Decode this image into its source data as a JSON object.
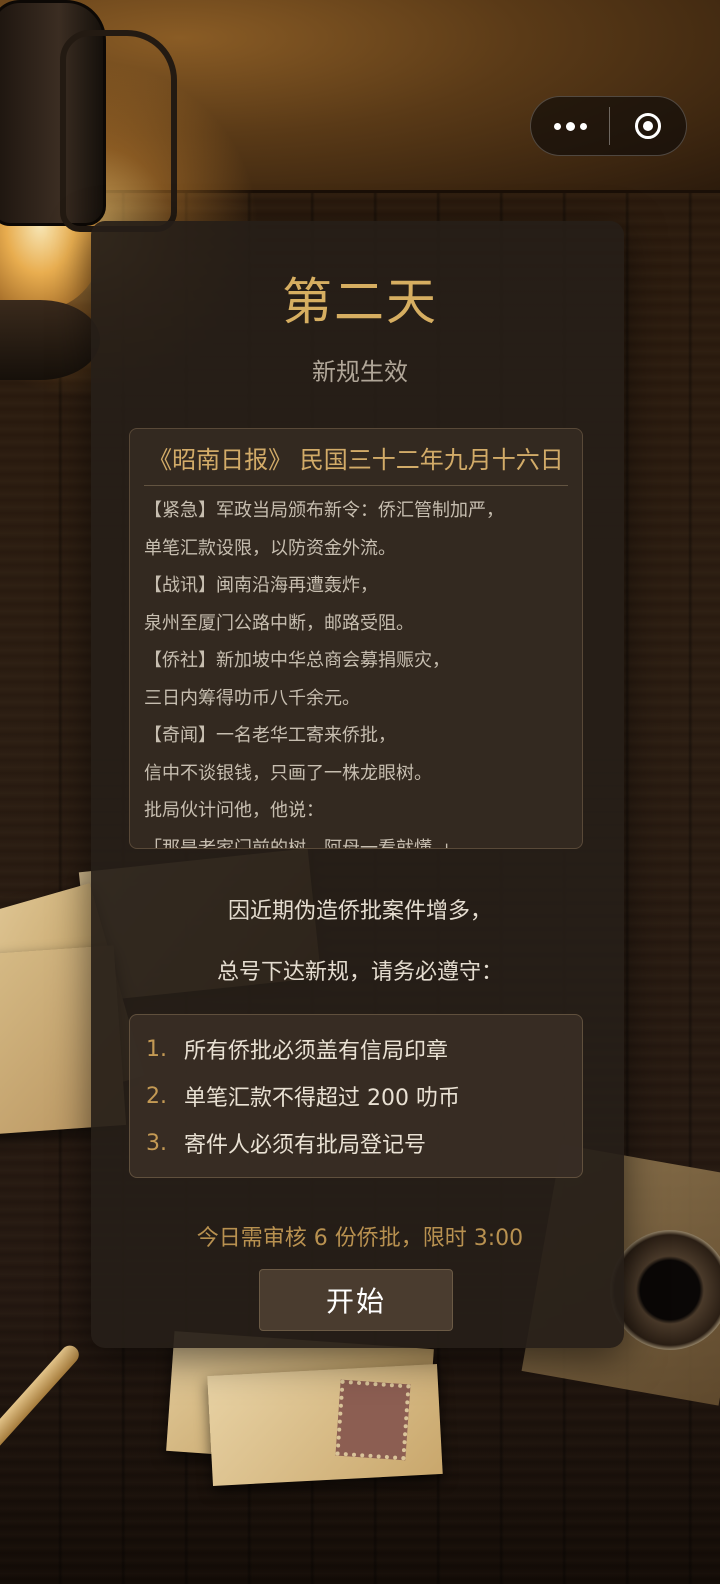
{
  "capsule": {
    "more_icon": "more-dots-icon",
    "close_icon": "target-circle-icon"
  },
  "screen": {
    "title": "第二天",
    "subtitle": "新规生效"
  },
  "newspaper": {
    "header": "《昭南日报》 民国三十二年九月十六日",
    "lines": [
      "【紧急】军政当局颁布新令：侨汇管制加严，",
      "单笔汇款设限，以防资金外流。",
      "【战讯】闽南沿海再遭轰炸，",
      "泉州至厦门公路中断，邮路受阻。",
      "【侨社】新加坡中华总商会募捐赈灾，",
      "三日内筹得叻币八千余元。",
      "【奇闻】一名老华工寄来侨批，",
      "信中不谈银钱，只画了一株龙眼树。",
      "批局伙计问他，他说：",
      "「那是老家门前的树，阿母一看就懂。」"
    ]
  },
  "notice": {
    "line1": "因近期伪造侨批案件增多，",
    "line2": "总号下达新规，请务必遵守："
  },
  "rules": [
    {
      "num": "1.",
      "text": "所有侨批必须盖有信局印章"
    },
    {
      "num": "2.",
      "text": "单笔汇款不得超过 200 叻币"
    },
    {
      "num": "3.",
      "text": "寄件人必须有批局登记号"
    }
  ],
  "task": "今日需审核 6 份侨批，限时 3:00",
  "start_button": "开始",
  "colors": {
    "accent_gold": "#d6ae61",
    "card_bg": "#261e18",
    "button_bg": "#4a3c2f"
  }
}
